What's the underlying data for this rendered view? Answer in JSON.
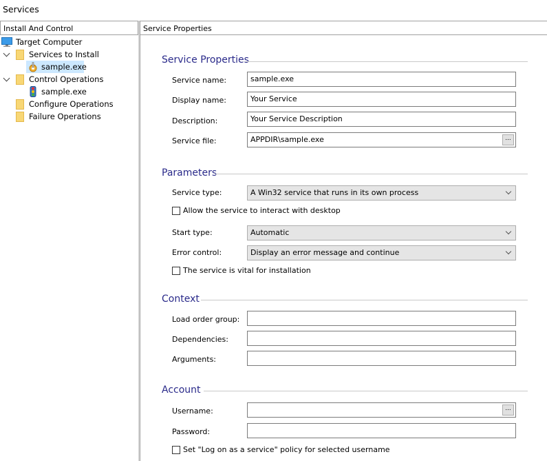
{
  "window": {
    "title": "Services"
  },
  "left_pane": {
    "header": "Install And Control",
    "tree": [
      {
        "label": "Target Computer",
        "icon": "computer-icon",
        "level": 0
      },
      {
        "label": "Services to Install",
        "icon": "folder-icon",
        "level": 1,
        "expanded": true
      },
      {
        "label": "sample.exe",
        "icon": "service-gear-icon",
        "level": 2,
        "selected": true
      },
      {
        "label": "Control Operations",
        "icon": "folder-icon",
        "level": 1,
        "expanded": true
      },
      {
        "label": "sample.exe",
        "icon": "traffic-light-icon",
        "level": 2
      },
      {
        "label": "Configure Operations",
        "icon": "folder-icon",
        "level": 1
      },
      {
        "label": "Failure Operations",
        "icon": "folder-icon",
        "level": 1
      }
    ]
  },
  "right_pane": {
    "header": "Service Properties",
    "sections": {
      "service_properties": {
        "title": "Service Properties",
        "service_name": {
          "label": "Service name:",
          "value": "sample.exe"
        },
        "display_name": {
          "label": "Display name:",
          "value": "Your Service"
        },
        "description": {
          "label": "Description:",
          "value": "Your Service Description"
        },
        "service_file": {
          "label": "Service file:",
          "value": "APPDIR\\sample.exe",
          "browse_label": "..."
        }
      },
      "parameters": {
        "title": "Parameters",
        "service_type": {
          "label": "Service type:",
          "value": "A Win32 service that runs in its own process"
        },
        "interact_desktop": {
          "label": "Allow the service to interact with desktop",
          "checked": false
        },
        "start_type": {
          "label": "Start type:",
          "value": "Automatic"
        },
        "error_control": {
          "label": "Error control:",
          "value": "Display an error message and continue"
        },
        "vital": {
          "label": "The service is vital for installation",
          "checked": false
        }
      },
      "context": {
        "title": "Context",
        "load_order_group": {
          "label": "Load order group:",
          "value": ""
        },
        "dependencies": {
          "label": "Dependencies:",
          "value": ""
        },
        "arguments": {
          "label": "Arguments:",
          "value": ""
        }
      },
      "account": {
        "title": "Account",
        "username": {
          "label": "Username:",
          "value": "",
          "browse_label": "..."
        },
        "password": {
          "label": "Password:",
          "value": ""
        },
        "logon_policy": {
          "label": "Set \"Log on as a service\" policy for selected username",
          "checked": false
        }
      }
    }
  }
}
